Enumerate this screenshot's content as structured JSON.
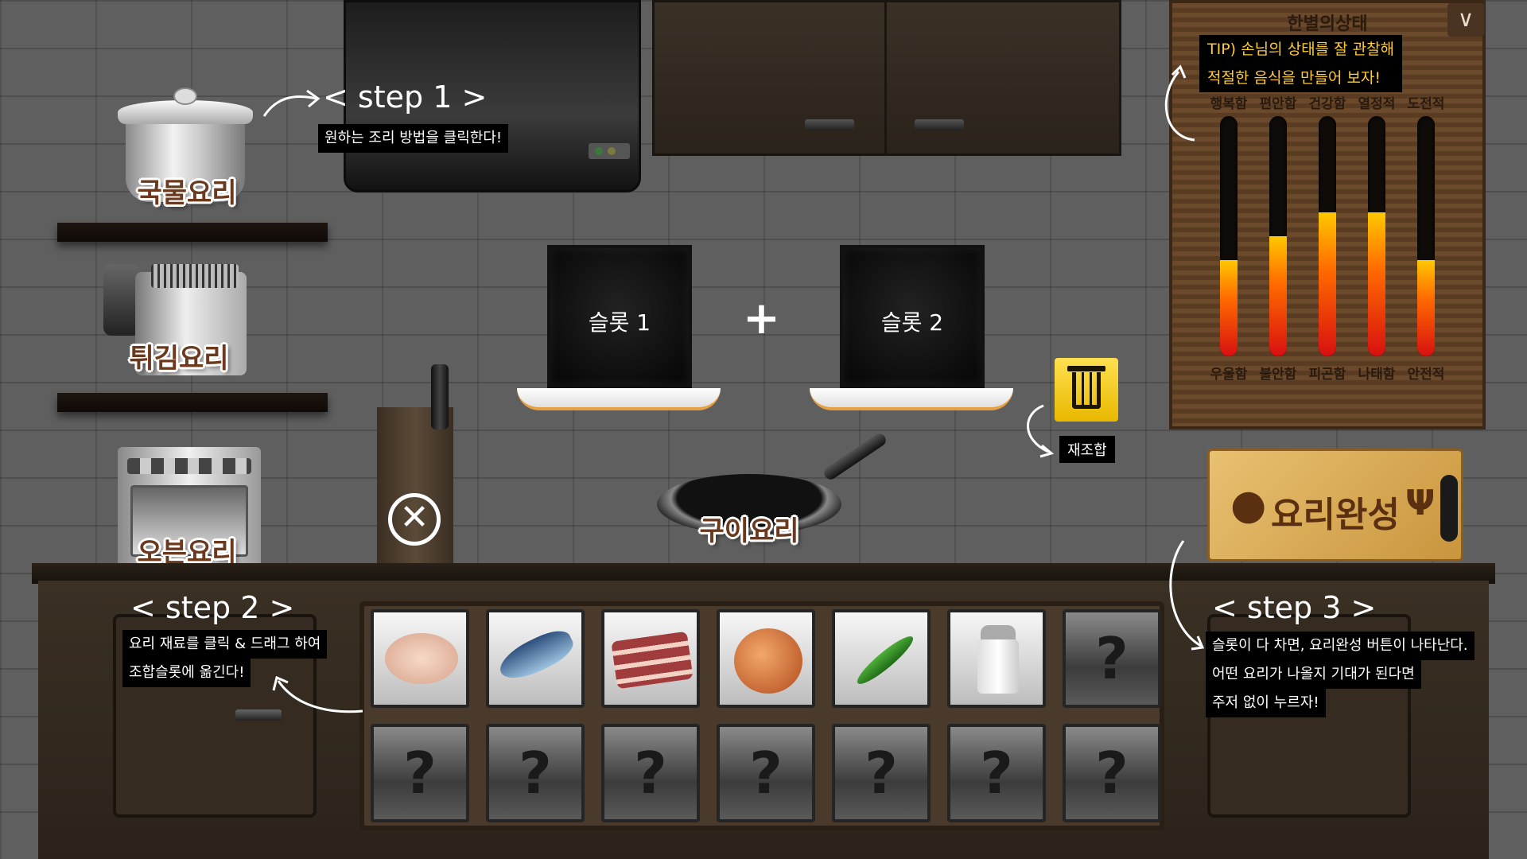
{
  "methods": {
    "soup": "국물요리",
    "fry": "튀김요리",
    "oven": "오븐요리",
    "grill": "구이요리"
  },
  "slots": {
    "slot1": "슬롯 1",
    "plus": "+",
    "slot2": "슬롯 2"
  },
  "trash": {
    "label": "재조합",
    "icon": "trash-icon"
  },
  "close": {
    "icon": "close-circle-icon",
    "glyph": "✕"
  },
  "status_board": {
    "title": "한별의상태",
    "toggle_glyph": "∨",
    "tip_line1": "TIP) 손님의 상태를 잘 관찰해",
    "tip_line2": "적절한 음식을 만들어 보자!",
    "stats": [
      {
        "top": "행복함",
        "bottom": "우울함",
        "level": 0.4
      },
      {
        "top": "편안함",
        "bottom": "불안함",
        "level": 0.5
      },
      {
        "top": "건강함",
        "bottom": "피곤함",
        "level": 0.6
      },
      {
        "top": "열정적",
        "bottom": "나태함",
        "level": 0.6
      },
      {
        "top": "도전적",
        "bottom": "안전적",
        "level": 0.4
      }
    ]
  },
  "complete_button": {
    "label": "요리완성",
    "icons": [
      "spoon-icon",
      "fork-icon"
    ]
  },
  "steps": {
    "step1": {
      "title": "< step 1 >",
      "text": "원하는 조리 방법을 클릭한다!"
    },
    "step2": {
      "title": "< step 2 >",
      "line1": "요리 재료를 클릭 & 드래그 하여",
      "line2": "조합슬롯에 옮긴다!"
    },
    "step3": {
      "title": "< step 3 >",
      "line1": "슬롯이 다 차면, 요리완성 버튼이 나타난다.",
      "line2": "어떤 요리가 나올지 기대가 된다면",
      "line3": "주저 없이 누르자!"
    }
  },
  "ingredients": {
    "row1": [
      {
        "name": "chicken-icon",
        "locked": false
      },
      {
        "name": "fish-icon",
        "locked": false
      },
      {
        "name": "pork-belly-icon",
        "locked": false
      },
      {
        "name": "ham-icon",
        "locked": false
      },
      {
        "name": "chili-pepper-icon",
        "locked": false
      },
      {
        "name": "salt-shaker-icon",
        "locked": false
      },
      {
        "name": "locked-icon",
        "locked": true,
        "glyph": "?"
      }
    ],
    "row2": [
      {
        "name": "locked-icon",
        "locked": true,
        "glyph": "?"
      },
      {
        "name": "locked-icon",
        "locked": true,
        "glyph": "?"
      },
      {
        "name": "locked-icon",
        "locked": true,
        "glyph": "?"
      },
      {
        "name": "locked-icon",
        "locked": true,
        "glyph": "?"
      },
      {
        "name": "locked-icon",
        "locked": true,
        "glyph": "?"
      },
      {
        "name": "locked-icon",
        "locked": true,
        "glyph": "?"
      },
      {
        "name": "locked-icon",
        "locked": true,
        "glyph": "?"
      }
    ]
  },
  "colors": {
    "wall": "#5f5f5f",
    "board_text": "#2a1a0e",
    "tip_text": "#ffcc33",
    "trash": "#ffd21f",
    "complete": "#e0b460",
    "label_brown": "#6b3a1e"
  }
}
